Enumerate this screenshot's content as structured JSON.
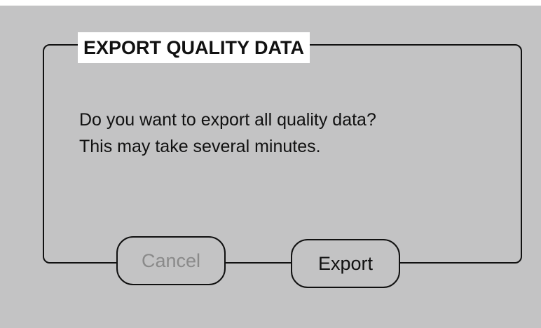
{
  "dialog": {
    "title": "EXPORT QUALITY DATA",
    "message_line1": "Do you want to export all quality data?",
    "message_line2": "This may take several minutes.",
    "cancel_label": "Cancel",
    "export_label": "Export",
    "cancel_enabled": false
  },
  "colors": {
    "background": "#c3c3c4",
    "frame": "#111111",
    "disabled_text": "#8a8a8a"
  }
}
